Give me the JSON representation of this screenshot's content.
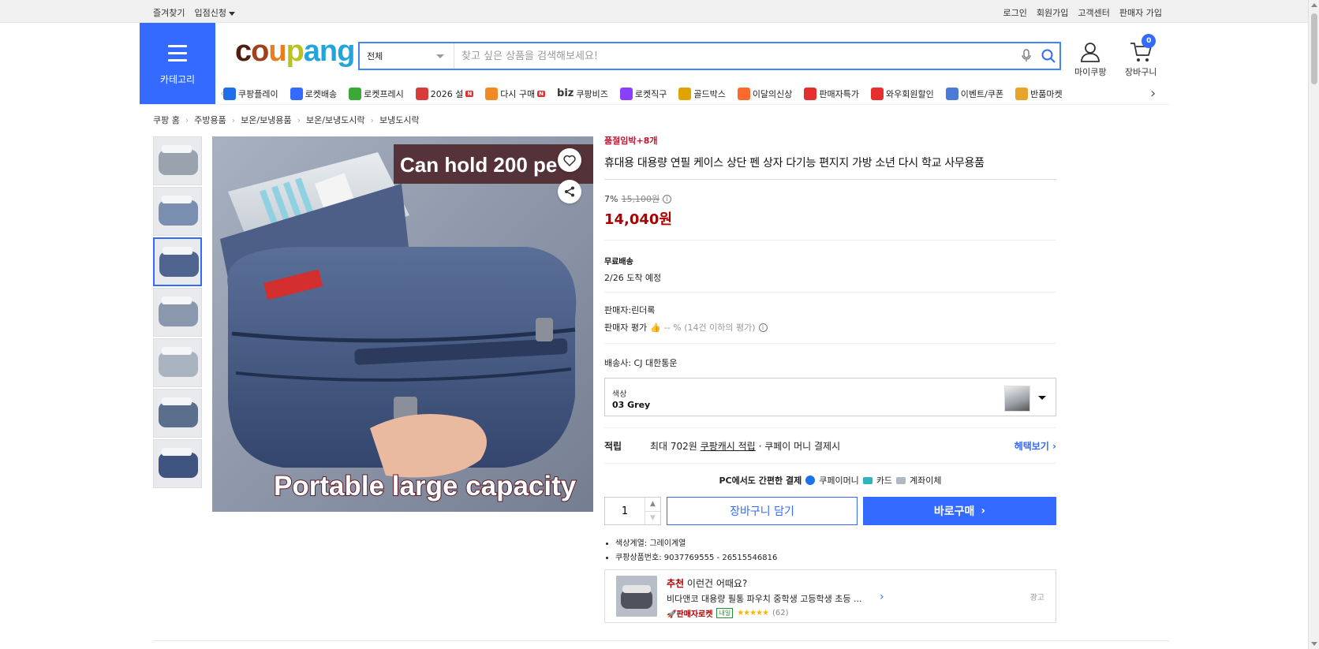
{
  "topbar": {
    "left": [
      "즐겨찾기",
      "입점신청"
    ],
    "right": [
      "로그인",
      "회원가입",
      "고객센터",
      "판매자 가입"
    ]
  },
  "header": {
    "category_label": "카테고리",
    "logo": [
      "c",
      "o",
      "u",
      "p",
      "ang"
    ],
    "search_scope": "전체",
    "search_placeholder": "찾고 싶은 상품을 검색해보세요!",
    "mycoupang_label": "마이쿠팡",
    "cart_label": "장바구니",
    "cart_count": "0"
  },
  "gnb": [
    {
      "label": "쿠팡플레이",
      "icon": "play-icon",
      "color": "#1f6feb"
    },
    {
      "label": "로켓배송",
      "icon": "rocket-icon",
      "color": "#346aff"
    },
    {
      "label": "로켓프레시",
      "icon": "rocket-fresh-icon",
      "color": "#3aa935"
    },
    {
      "label": "2026 설",
      "icon": "gift-icon",
      "color": "#d93b3b",
      "badge": "N"
    },
    {
      "label": "다시 구매",
      "icon": "reorder-icon",
      "color": "#f08a24",
      "badge": "N"
    },
    {
      "label": "쿠팡비즈",
      "icon": "biz-icon",
      "color": "#333333",
      "prefix": "biz"
    },
    {
      "label": "로켓직구",
      "icon": "global-icon",
      "color": "#8a3ffc"
    },
    {
      "label": "골드박스",
      "icon": "goldbox-icon",
      "color": "#e0a400"
    },
    {
      "label": "이달의신상",
      "icon": "bag-icon",
      "color": "#ff6a2c"
    },
    {
      "label": "판매자특가",
      "icon": "sale-icon",
      "color": "#e52e2e"
    },
    {
      "label": "와우회원할인",
      "icon": "wow-icon",
      "color": "#e52e2e"
    },
    {
      "label": "이벤트/쿠폰",
      "icon": "coupon-icon",
      "color": "#4a7bd6"
    },
    {
      "label": "반품마켓",
      "icon": "market-icon",
      "color": "#e8a32a"
    }
  ],
  "breadcrumb": [
    "쿠팡 홈",
    "주방용품",
    "보온/보냉용품",
    "보온/보냉도시락",
    "보냉도시락"
  ],
  "product": {
    "urgency": "품절임박+8개",
    "title": "휴대용 대용량 연필 케이스 상단 펜 상자 다기능 편지지 가방 소년 다시 학교 사무용품",
    "discount_rate": "7%",
    "original_price": "15,100원",
    "sale_price": "14,040원",
    "shipping_label": "무료배송",
    "arrival": "2/26 도착 예정",
    "seller": "판매자:린더록",
    "seller_rating_label": "판매자 평가",
    "seller_rating_value": "-- % (14건 이하의 평가)",
    "carrier": "배송사:  CJ 대한통운",
    "option_key": "색상",
    "option_value": "03 Grey",
    "reward_label": "적립",
    "reward_prefix": "최대 702원",
    "reward_link": "쿠팡캐시 적립",
    "reward_suffix": "· 쿠페이 머니 결제시",
    "reward_more": "헤택보기 ›",
    "pay_title": "PC에서도 간편한 결제",
    "pay_methods": [
      "쿠페이머니",
      "카드",
      "계좌이체"
    ],
    "quantity": "1",
    "cart_button": "장바구니 담기",
    "buy_button": "바로구매",
    "attributes": [
      "색상계열: 그레이계열",
      "쿠팡상품번호: 9037769555 - 26515546816"
    ],
    "main_image_text_top": "Can hold 200 pe",
    "main_image_text_bottom": "Portable large capacity",
    "thumb_count": 7,
    "active_thumb": 2
  },
  "recommend": {
    "head_em": "추천",
    "head_rest": " 이런건 어때요?",
    "name": "비다앤코 대용량 필통 파우치 중학생 고등학생 초등 ...",
    "badge": "판매자로켓",
    "badge2": "내일",
    "stars": "★★★★★",
    "count": "(62)",
    "ad": "광고"
  }
}
